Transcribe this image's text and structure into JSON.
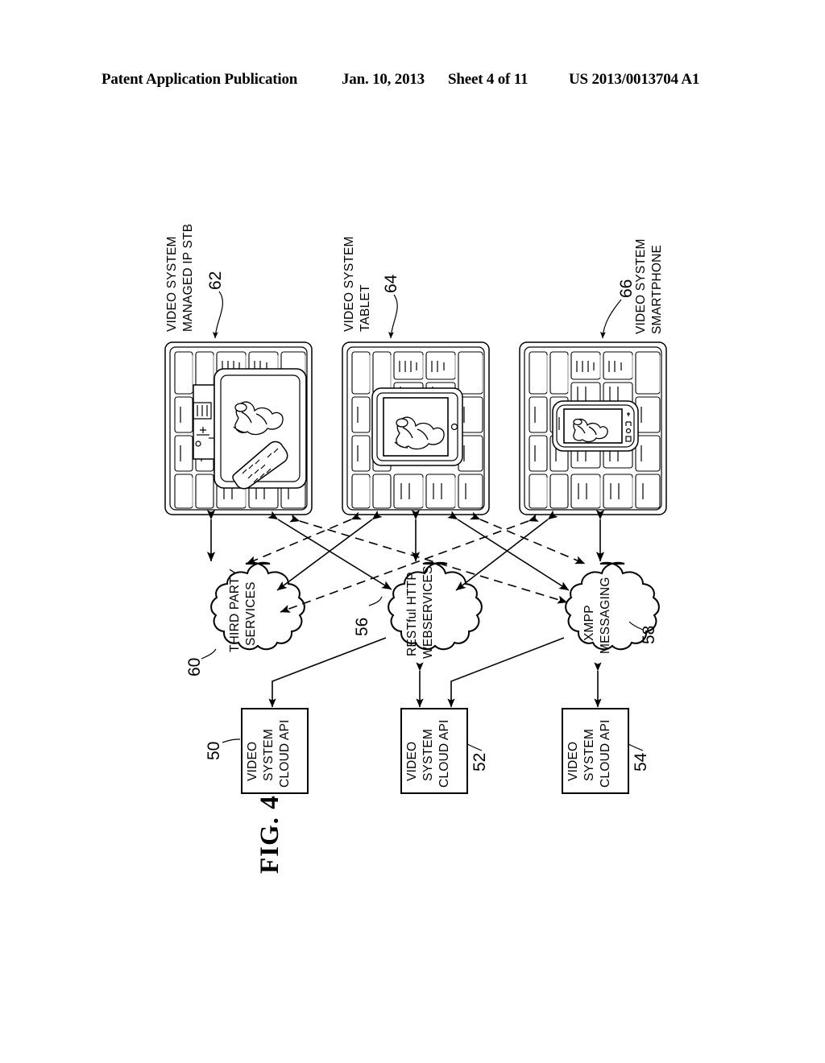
{
  "header": {
    "publication": "Patent Application Publication",
    "date": "Jan. 10, 2013",
    "sheet": "Sheet 4 of 11",
    "patent_number": "US 2013/0013704 A1"
  },
  "figure": {
    "caption": "FIG. 4"
  },
  "devices": [
    {
      "id": "stb",
      "label_line1": "VIDEO SYSTEM",
      "label_line2": "MANAGED IP STB",
      "ref": "62"
    },
    {
      "id": "tablet",
      "label_line1": "VIDEO SYSTEM",
      "label_line2": "TABLET",
      "ref": "64"
    },
    {
      "id": "smartphone",
      "label_line1": "VIDEO SYSTEM",
      "label_line2": "SMARTPHONE",
      "ref": "66"
    }
  ],
  "clouds": [
    {
      "id": "third-party-services",
      "label_line1": "THIRD PARTY",
      "label_line2": "SERVICES",
      "ref": "60"
    },
    {
      "id": "restful-http-webservices",
      "label_line1": "RESTful HTTP",
      "label_line2": "WEBSERVICES",
      "ref": "56"
    },
    {
      "id": "xmpp-messaging",
      "label_line1": "XMPP",
      "label_line2": "MESSAGING",
      "ref": "58"
    }
  ],
  "api_boxes": [
    {
      "id": "cloud-api-50",
      "label_line1": "VIDEO",
      "label_line2": "SYSTEM",
      "label_line3": "CLOUD API",
      "ref": "50"
    },
    {
      "id": "cloud-api-52",
      "label_line1": "VIDEO",
      "label_line2": "SYSTEM",
      "label_line3": "CLOUD API",
      "ref": "52"
    },
    {
      "id": "cloud-api-54",
      "label_line1": "VIDEO",
      "label_line2": "SYSTEM",
      "label_line3": "CLOUD API",
      "ref": "54"
    }
  ],
  "colors": {
    "ink": "#000000",
    "paper": "#ffffff",
    "shadow": "#bdbdbd"
  }
}
